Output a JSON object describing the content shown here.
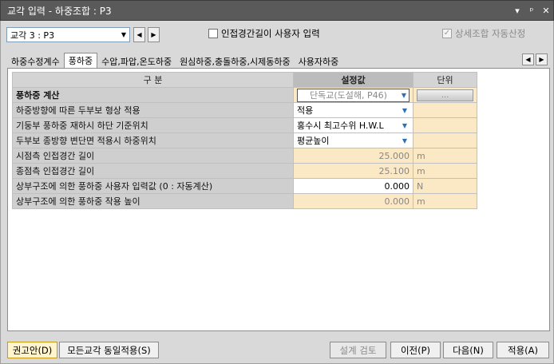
{
  "window": {
    "title": "교각 입력 - 하중조합 : P3",
    "controls": [
      "▾",
      "ᵖ",
      "✕"
    ]
  },
  "top": {
    "pier_select": "교각 3 : P3",
    "adjacent_checkbox_label": "인접경간길이 사용자 입력",
    "adjacent_checked": false,
    "detail_checkbox_label": "상세조합 자동산정",
    "detail_checked": true
  },
  "tabs": [
    {
      "label": "하중수정계수",
      "active": false
    },
    {
      "label": "풍하중",
      "active": true
    },
    {
      "label": "수압,파압,온도하중",
      "active": false
    },
    {
      "label": "원심하중,충돌하중,시제동하중",
      "active": false
    },
    {
      "label": "사용자하중",
      "active": false
    }
  ],
  "grid": {
    "headers": {
      "item": "구 분",
      "setting": "설정값",
      "unit": "단위"
    },
    "rows": [
      {
        "label": "풍하중 계산",
        "value": "단독교(도설해, P46)",
        "unit": "...",
        "kind": "title"
      },
      {
        "label": "하중방향에 따른 두부보 형상 적용",
        "value": "적용",
        "unit": "",
        "kind": "dropdown"
      },
      {
        "label": "기둥부 풍하중 재하시 하단 기준위치",
        "value": "홍수시 최고수위 H.W.L",
        "unit": "",
        "kind": "dropdown"
      },
      {
        "label": "두부보 종방향 변단면 적용시 하중위치",
        "value": "평균높이",
        "unit": "",
        "kind": "dropdown"
      },
      {
        "label": "시점측 인접경간 길이",
        "value": "25.000",
        "unit": "m",
        "kind": "readonly"
      },
      {
        "label": "종점측 인접경간 길이",
        "value": "25.100",
        "unit": "m",
        "kind": "readonly"
      },
      {
        "label": "상부구조에 의한 풍하중 사용자 입력값 (0 : 자동계산)",
        "value": "0.000",
        "unit": "N",
        "kind": "input"
      },
      {
        "label": "상부구조에 의한 풍하중 작용 높이",
        "value": "0.000",
        "unit": "m",
        "kind": "readonly"
      }
    ]
  },
  "buttons": {
    "recommend": "권고안(D)",
    "apply_all": "모든교각 동일적용(S)",
    "check": "설계 검토",
    "prev": "이전(P)",
    "next": "다음(N)",
    "apply": "적용(A)"
  }
}
